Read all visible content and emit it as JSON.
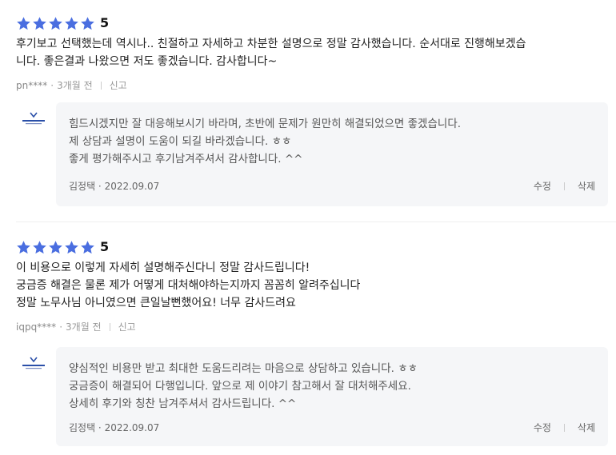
{
  "colors": {
    "star": "#4a6ee0",
    "reply_bg": "#f5f6f8",
    "meta": "#999999"
  },
  "reviews": [
    {
      "stars": 5,
      "score": "5",
      "text_lines": [
        "후기보고 선택했는데 역시나.. 친절하고 자세하고 차분한 설명으로 정말 감사했습니다. 순서대로 진행해보겠습",
        "니다. 좋은결과 나왔으면 저도 좋겠습니다. 감사합니다~"
      ],
      "user": "pn****",
      "time": "3개월 전",
      "report": "신고",
      "reply": {
        "logo_icon": "labor-attorney-logo-icon",
        "lines": [
          "힘드시겠지만 잘 대응해보시기 바라며, 초반에 문제가 원만히 해결되었으면 좋겠습니다.",
          "제 상담과 설명이 도움이 되길 바라겠습니다. ㅎㅎ",
          "좋게 평가해주시고 후기남겨주셔서 감사합니다. ^^"
        ],
        "author_date": "김정택 · 2022.09.07",
        "edit": "수정",
        "delete": "삭제"
      }
    },
    {
      "stars": 5,
      "score": "5",
      "text_lines": [
        "이 비용으로 이렇게 자세히 설명해주신다니 정말 감사드립니다!",
        "궁금증 해결은 물론 제가 어떻게 대처해야하는지까지 꼼꼼히 알려주십니다",
        "정말 노무사님 아니였으면 큰일날뻔했어요! 너무 감사드려요"
      ],
      "user": "iqpq****",
      "time": "3개월 전",
      "report": "신고",
      "reply": {
        "logo_icon": "labor-attorney-logo-icon",
        "lines": [
          "양심적인 비용만 받고 최대한 도움드리려는 마음으로 상담하고 있습니다. ㅎㅎ",
          "궁금증이 해결되어 다행입니다. 앞으로 제 이야기 참고해서 잘 대처해주세요.",
          "상세히 후기와 칭찬 남겨주셔서 감사드립니다. ^^"
        ],
        "author_date": "김정택 · 2022.09.07",
        "edit": "수정",
        "delete": "삭제"
      }
    }
  ]
}
